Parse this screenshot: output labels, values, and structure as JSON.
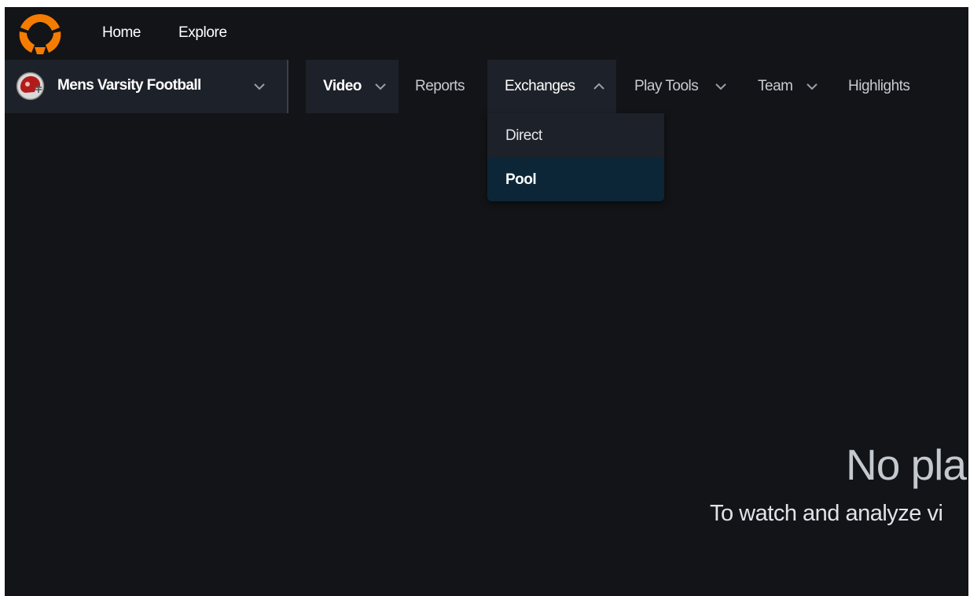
{
  "top_nav": {
    "links": [
      "Home",
      "Explore"
    ]
  },
  "team_selector": {
    "name": "Mens Varsity Football",
    "icon": "chevron-down-icon"
  },
  "sub_nav": {
    "items": [
      {
        "label": "Video",
        "icon": "chevron-down-icon"
      },
      {
        "label": "Reports"
      },
      {
        "label": "Exchanges",
        "icon": "chevron-up-icon",
        "expanded": true
      },
      {
        "label": "Play Tools",
        "icon": "chevron-down-icon"
      },
      {
        "label": "Team",
        "icon": "chevron-down-icon"
      },
      {
        "label": "Highlights"
      }
    ]
  },
  "exchanges_dropdown": {
    "items": [
      {
        "label": "Direct"
      },
      {
        "label": "Pool",
        "selected": true
      }
    ]
  },
  "empty_state": {
    "title": "No pla",
    "subtitle": "To watch and analyze vi"
  },
  "colors": {
    "brand_orange": "#f57c00",
    "background": "#121417",
    "selector_bg": "#1d2129",
    "active_item_bg": "#0c2637"
  }
}
